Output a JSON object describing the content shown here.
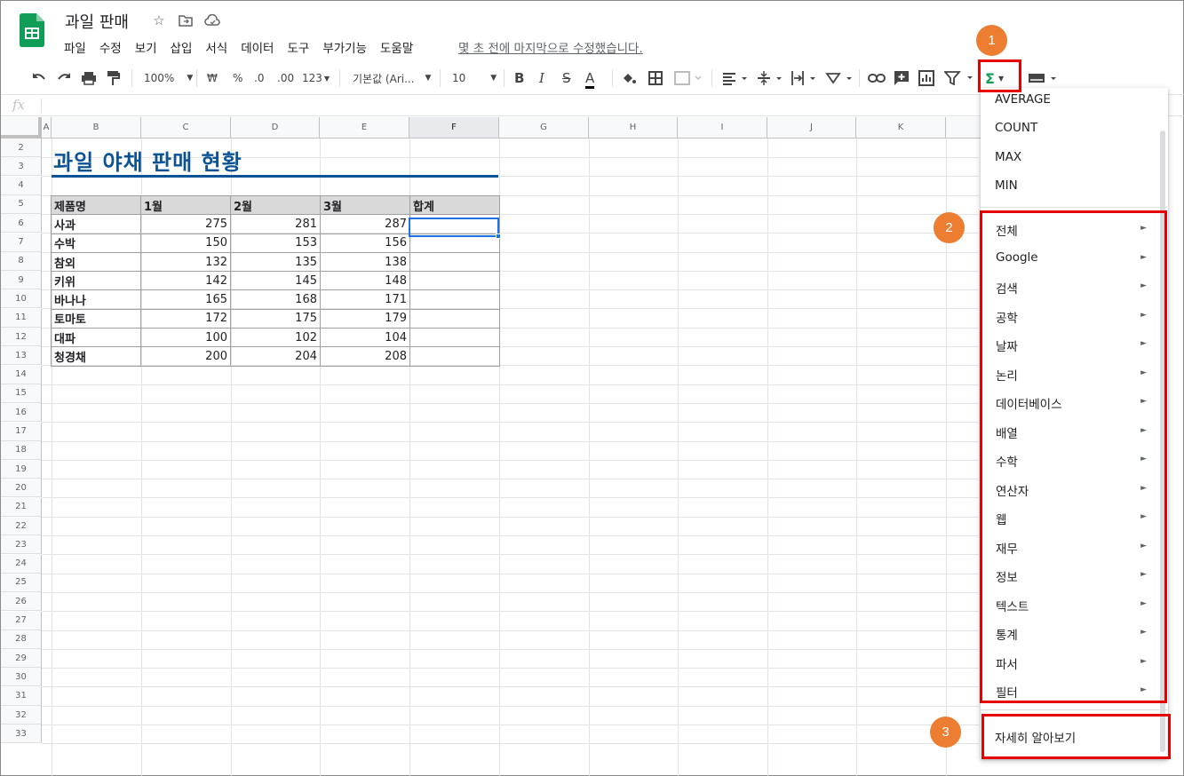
{
  "app": {
    "doc_title": "과일 판매",
    "menu": [
      "파일",
      "수정",
      "보기",
      "삽입",
      "서식",
      "데이터",
      "도구",
      "부가기능",
      "도움말"
    ],
    "last_edit": "몇 초 전에 마지막으로 수정했습니다.",
    "brand_color": "#0f9d58"
  },
  "toolbar": {
    "zoom": "100%",
    "currency": "₩",
    "percent": "%",
    "dec_decrease": ".0",
    "dec_increase": ".00",
    "number_format": "123",
    "font": "기본값 (Ari...",
    "font_size": "10",
    "bold": "B",
    "italic": "I",
    "strike": "S",
    "text_color": "A",
    "function": "Σ"
  },
  "formula_bar": {
    "fx": "fx"
  },
  "grid": {
    "columns": [
      "A",
      "B",
      "C",
      "D",
      "E",
      "F",
      "G",
      "H",
      "I",
      "J",
      "K"
    ],
    "rows": [
      "2",
      "3",
      "4",
      "5",
      "6",
      "7",
      "8",
      "9",
      "10",
      "11",
      "12",
      "13",
      "14",
      "15",
      "16",
      "17",
      "18",
      "19",
      "20",
      "21",
      "22",
      "23",
      "24",
      "25",
      "26",
      "27",
      "28",
      "29",
      "30",
      "31",
      "32",
      "33"
    ]
  },
  "sheet": {
    "title": "과일 야채 판매 현황",
    "header": [
      "제품명",
      "1월",
      "2월",
      "3월",
      "합계"
    ],
    "rows": [
      [
        "사과",
        "275",
        "281",
        "287",
        ""
      ],
      [
        "수박",
        "150",
        "153",
        "156",
        ""
      ],
      [
        "참외",
        "132",
        "135",
        "138",
        ""
      ],
      [
        "키위",
        "142",
        "145",
        "148",
        ""
      ],
      [
        "바나나",
        "165",
        "168",
        "171",
        ""
      ],
      [
        "토마토",
        "172",
        "175",
        "179",
        ""
      ],
      [
        "대파",
        "100",
        "102",
        "104",
        ""
      ],
      [
        "청경채",
        "200",
        "204",
        "208",
        ""
      ]
    ],
    "title_color": "#0b5394"
  },
  "function_menu": {
    "quick": [
      "AVERAGE",
      "COUNT",
      "MAX",
      "MIN"
    ],
    "categories": [
      "전체",
      "Google",
      "검색",
      "공학",
      "날짜",
      "논리",
      "데이터베이스",
      "배열",
      "수학",
      "연산자",
      "웹",
      "재무",
      "정보",
      "텍스트",
      "통계",
      "파서",
      "필터"
    ],
    "learn_more": "자세히 알아보기"
  },
  "annotations": {
    "badges": [
      "1",
      "2",
      "3"
    ],
    "highlight_color": "#e60000",
    "badge_color": "#ed7d31"
  }
}
